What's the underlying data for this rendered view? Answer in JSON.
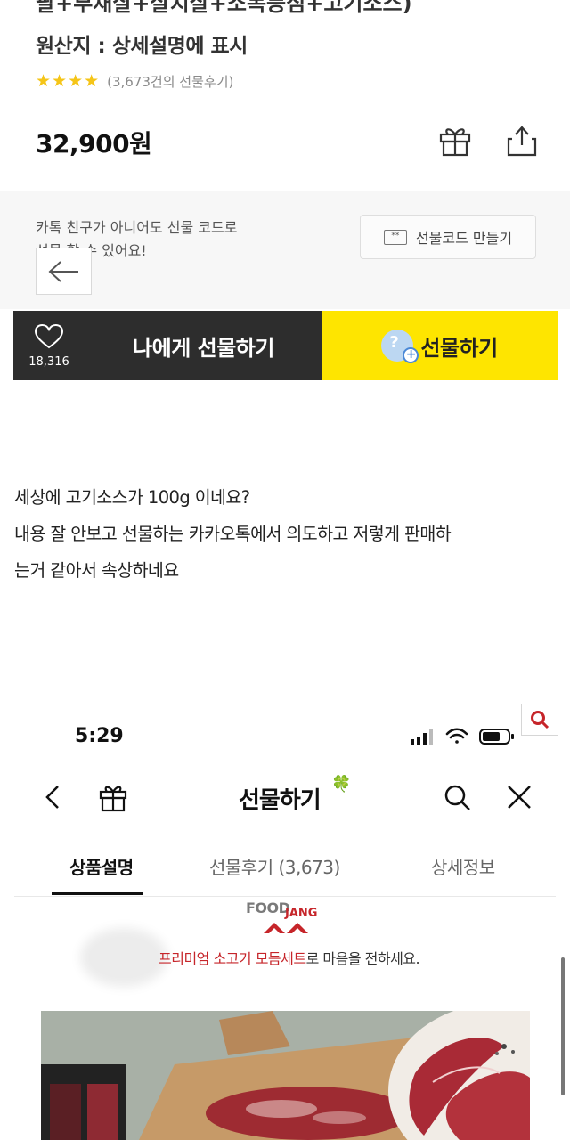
{
  "top_screenshot": {
    "truncated_title": "팔+부채살+살치살+소목등심+고기소스)",
    "origin": "원산지 : 상세설명에 표시",
    "rating": {
      "stars": "★★★★",
      "reviews": "(3,673건의 선물후기)"
    },
    "price": "32,900원",
    "icons": [
      "gift-icon",
      "share-icon"
    ],
    "notice": "카톡 친구가 아니어도 선물 코드로\n선물 할 수 있어요!",
    "gift_code_button": "선물코드 만들기",
    "gift_code_icon": "**",
    "like_count": "18,316",
    "self_gift_button": "나에게 선물하기",
    "gift_button": "선물하기",
    "gift_badge": {
      "q": "?",
      "plus": "+"
    }
  },
  "post": {
    "line1": "세상에 고기소스가 100g 이네요?",
    "line2": "내용 잘 안보고 선물하는 카카오톡에서 의도하고 저렇게 판매하\n는거 같아서 속상하네요"
  },
  "bottom_screenshot": {
    "time": "5:29",
    "nav_title": "선물하기",
    "clover": "🍀",
    "tabs": [
      {
        "label": "상품설명",
        "active": true
      },
      {
        "label": "선물후기 (3,673)",
        "active": false
      },
      {
        "label": "상세정보",
        "active": false
      }
    ],
    "brand": {
      "food": "FOOD",
      "jang": "JANG"
    },
    "promo": {
      "highlight": "프리미엄 소고기 모듬세트",
      "rest": "로 마음을 전하세요."
    }
  },
  "colors": {
    "kakao_yellow": "#fee500",
    "dark_bar": "#2d2d2d",
    "star": "#f5c518",
    "brand_red": "#c6252a"
  }
}
